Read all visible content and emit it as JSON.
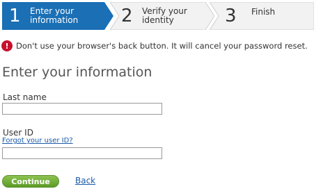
{
  "steps": [
    {
      "number": "1",
      "label_line1": "Enter your",
      "label_line2": "information"
    },
    {
      "number": "2",
      "label_line1": "Verify your",
      "label_line2": "identity"
    },
    {
      "number": "3",
      "label_line1": "Finish",
      "label_line2": ""
    }
  ],
  "colors": {
    "active_step": "#1a6fb5",
    "inactive_step": "#f2f2f2",
    "error": "#c8102e",
    "continue": "#6aab35",
    "link": "#1a5aa8"
  },
  "warning": {
    "icon": "!",
    "text": "Don't use your browser's back button. It will cancel your password reset."
  },
  "form": {
    "title": "Enter your information",
    "last_name_label": "Last name",
    "last_name_value": "",
    "user_id_label": "User ID",
    "forgot_link": "Forgot your user ID?",
    "user_id_value": ""
  },
  "actions": {
    "continue_label": "Continue",
    "back_label": "Back"
  }
}
